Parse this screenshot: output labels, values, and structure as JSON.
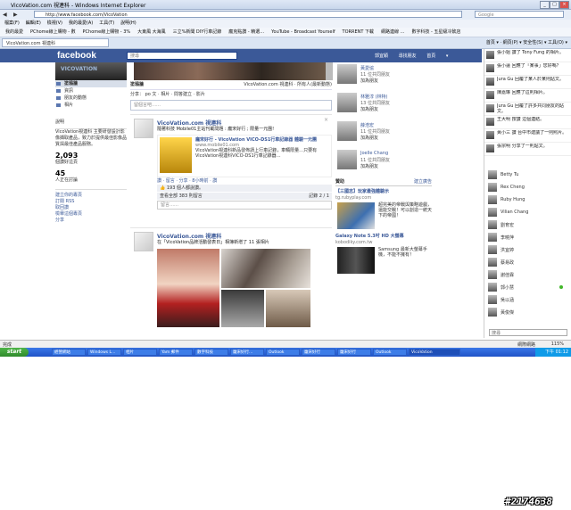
{
  "window": {
    "title": "VicoVation.com 視連科 - Windows Internet Explorer"
  },
  "address": {
    "url": "http://www.facebook.com/VicoVation",
    "search_placeholder": "Google"
  },
  "menubar": [
    "檔案(F)",
    "編輯(E)",
    "檢視(V)",
    "我的最愛(A)",
    "工具(T)",
    "說明(H)"
  ],
  "favorites": [
    "我的最愛",
    "PChome線上購物 - 數",
    "PChome線上購物 - 3%",
    "大東風 大海風",
    "三立%新聞 DIY行車記錄",
    "龐克點讚 - 精選…",
    "YouTube - Broadcast Yourself",
    "TORRENT 下載",
    "網路連線 …",
    "數字科技 - 五星級冷飲店"
  ],
  "tab": {
    "label": "VicoVation.com 視連科"
  },
  "tab_tools": "首頁 ▾  ·  網頁(P) ▾  安全性(S) ▾  工具(O) ▾",
  "fb": {
    "logo": "facebook",
    "search": "搜尋",
    "nav": [
      "郭宜穎",
      "尋找朋友",
      "首頁"
    ],
    "left": {
      "nav": [
        "塗鴉牆",
        "資訊",
        "朋友的動態",
        "相片"
      ],
      "about_title": "說明",
      "about_text": "VicoVation視連科 主要研發設計影像擷取產品，致力於提供最佳影像品質與最佳產品服務。",
      "likes_count": "2,093",
      "likes_label": "個讚好這頁",
      "talking_count": "45",
      "talking_label": "人正在討論",
      "links": [
        "建立你的專頁",
        "訂閱 RSS",
        "取回讚",
        "檢舉這個專頁",
        "分享"
      ]
    },
    "timeline": {
      "head_left": "塗鴉牆",
      "head_right": "VicoVation.com 視連科 · 所有人(最新動態)",
      "publish": [
        "分享：",
        "po 文",
        "相片",
        "問答建立",
        "影片"
      ],
      "compose_placeholder": "留個言吧……",
      "post1": {
        "author": "VicoVation.com 視連科",
        "text": "隨著科技 Mobile01主站刊載問題 : 龐宋好行 ; 限量一元團!",
        "link_title": "龐宋好行 - VicoVation VICO-DS1行車記錄器 體驗一元團",
        "link_url": "www.mobile01.com",
        "link_desc": "VicoVation視連科新品發佈請上行車記錄，車輛限量…只要有VicoVation視連科VICO-DS1行車記錄器…",
        "actions": "讚 · 留言 · 分享 · 8小時前 · 讚",
        "likes": "193 個人都說讚。",
        "comments": "查看全部 383 則留言",
        "comment_count": "記錄 2 / 1",
        "comment_placeholder": "留言……"
      },
      "post2": {
        "author": "VicoVation.com 視連科",
        "text": "在「VicoVation品牌活動發表日」相簿新增了 11 張相片"
      }
    },
    "friends": [
      {
        "name": "黃愛協",
        "sub": "11 位共同朋友",
        "btn": "加為朋友"
      },
      {
        "name": "林雅淳 (林特)",
        "sub": "13 位共同朋友",
        "btn": "加為朋友"
      },
      {
        "name": "薛浩宏",
        "sub": "11 位共同朋友",
        "btn": "加為朋友"
      },
      {
        "name": "Joelle Chang",
        "sub": "11 位共同朋友",
        "btn": "加為朋友"
      }
    ],
    "ads": {
      "header": "贊助",
      "header_link": "建立廣告",
      "ad1_title": "【三國志】玩家最強體驗示",
      "ad1_url": "tg.rubyplay.com",
      "ad1_text": "超完美的帝戰與策略遊戲，還能交戰！可以創造一統天下的帝國！",
      "ad2_title": "Galaxy Note 5.3吋 HD 大螢幕",
      "ad2_url": "kobodiky.com.tw",
      "ad2_text": "Samsung 最新大螢幕手機，不能不擁有！"
    },
    "ticker": [
      "張小姐 讚了 Tony Fung 的相片。",
      "張小蓮 回應了「某事」您好嗎？",
      "Jura Gu 回覆了某人於某則貼文。",
      "陳嘉琳 回應了這則相片。",
      "Jura Gu 回覆了許多共同朋友的貼文。",
      "王大明 按讚 這個連結。",
      "黃小三 讚 台中市建議了一則照片。",
      "張宗明 分享了一則貼文。"
    ],
    "chat": [
      {
        "name": "Betty Tu",
        "online": false
      },
      {
        "name": "Rex Cheng",
        "online": false
      },
      {
        "name": "Ruby Hung",
        "online": false
      },
      {
        "name": "Vilian Chang",
        "online": false
      },
      {
        "name": "劉育宏",
        "online": false
      },
      {
        "name": "李曉萍",
        "online": false
      },
      {
        "name": "洪宜婷",
        "online": false
      },
      {
        "name": "蔡易政",
        "online": false
      },
      {
        "name": "謝佳霖",
        "online": false
      },
      {
        "name": "郭小慧",
        "online": true
      },
      {
        "name": "吳以涵",
        "online": false
      },
      {
        "name": "黃俊傑",
        "online": false
      }
    ],
    "chat_search": "搜尋"
  },
  "statusbar": {
    "left": "完成",
    "zone": "網際網路",
    "zoom": "115%"
  },
  "taskbar": {
    "start": "start",
    "items": [
      "經營網站",
      "Windows L…",
      "相片",
      "Yam 郵件",
      "數字科技",
      "龐宋好行…",
      "Outlook",
      "龐宋好行",
      "龐宋好行",
      "Outlook",
      "VicoVation"
    ],
    "clock": "下午 01:12"
  },
  "watermark": "#2174638"
}
